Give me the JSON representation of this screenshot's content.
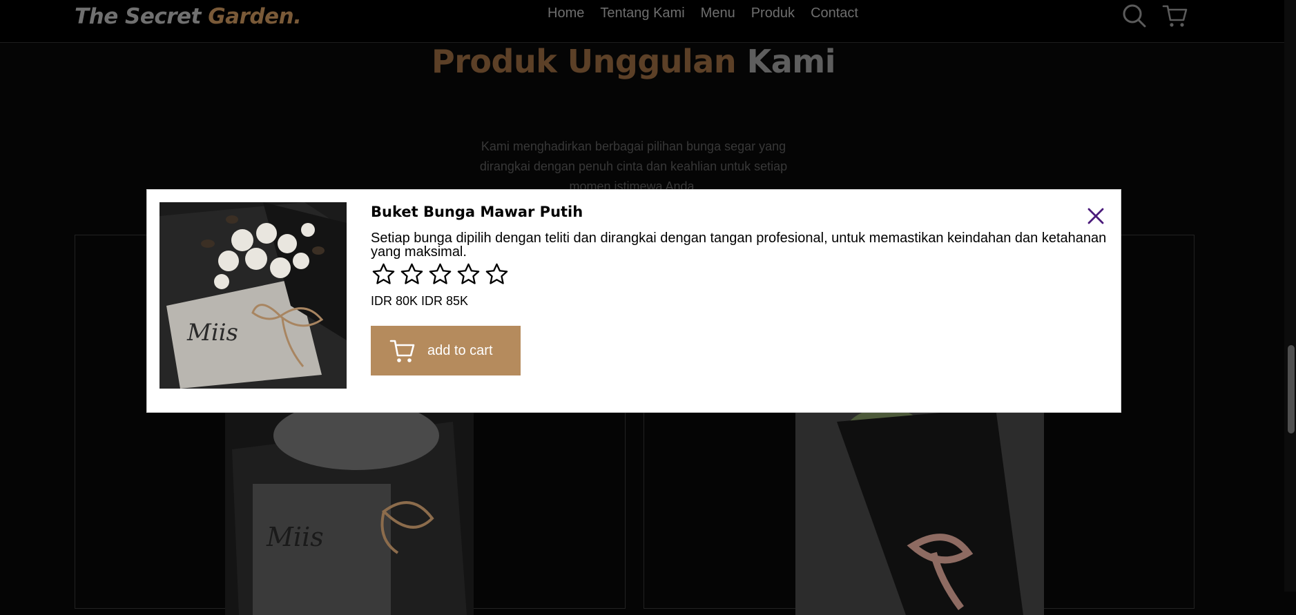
{
  "header": {
    "logo_part1": "The Secret",
    "logo_part2": "Garden.",
    "nav": [
      "Home",
      "Tentang Kami",
      "Menu",
      "Produk",
      "Contact"
    ]
  },
  "section": {
    "title_part1": "Produk Unggulan",
    "title_part2": "Kami",
    "description": "Kami menghadirkan berbagai pilihan bunga segar yang dirangkai dengan penuh cinta dan keahlian untuk setiap momen istimewa Anda."
  },
  "modal": {
    "title": "Buket Bunga Mawar Putih",
    "description": "Setiap bunga dipilih dengan teliti dan dirangkai dengan tangan profesional, untuk memastikan keindahan dan ketahanan yang maksimal.",
    "rating": 0,
    "rating_max": 5,
    "price": "IDR 80K IDR 85K",
    "add_to_cart_label": "add to cart"
  },
  "icons": {
    "search": "search-icon",
    "cart": "cart-icon",
    "close": "close-icon",
    "star": "star-outline-icon"
  },
  "colors": {
    "accent_brown": "#b58b5d",
    "close_purple": "#4a1a7a",
    "background": "#050505"
  }
}
